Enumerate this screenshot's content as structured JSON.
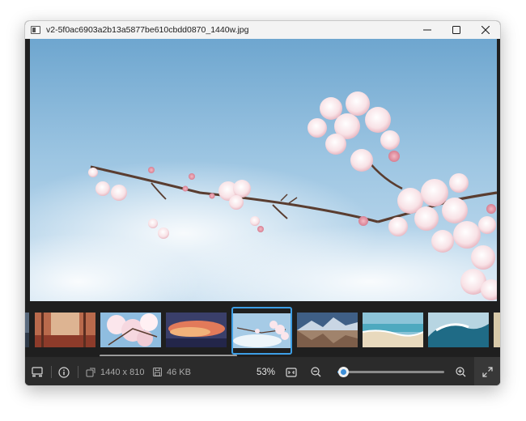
{
  "window": {
    "title": "v2-5f0ac6903a2b13a5877be610cbdd0870_1440w.jpg"
  },
  "filmstrip": {
    "items": [
      {
        "name": "autumn-forest"
      },
      {
        "name": "cherry-blossom-tree"
      },
      {
        "name": "sunset-clouds"
      },
      {
        "name": "cherry-blossom-branch",
        "selected": true
      },
      {
        "name": "mountain-lake"
      },
      {
        "name": "beach-shore"
      },
      {
        "name": "ocean-wave"
      }
    ],
    "scroll_fraction": 0.33
  },
  "toolbar": {
    "dimensions": "1440 x 810",
    "file_size": "46 KB",
    "zoom_label": "53%",
    "zoom_level": 0.05
  },
  "colors": {
    "accent": "#3d9fe6",
    "chrome": "#2b2b2b",
    "titlebar": "#f3f3f3"
  }
}
